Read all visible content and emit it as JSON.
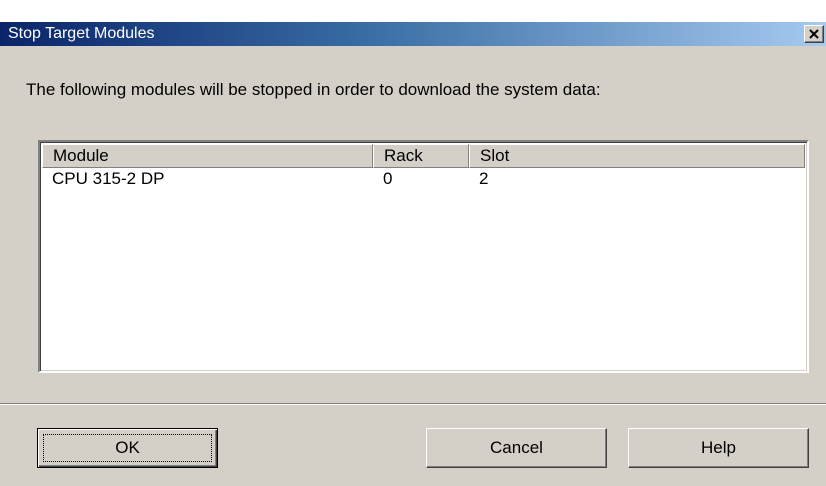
{
  "window": {
    "title": "Stop Target Modules",
    "close_icon": "close-icon"
  },
  "message": "The following modules will be stopped in order to download the system data:",
  "table": {
    "columns": [
      "Module",
      "Rack",
      "Slot"
    ],
    "rows": [
      [
        "CPU 315-2 DP",
        "0",
        "2"
      ]
    ]
  },
  "buttons": {
    "ok_label": "OK",
    "cancel_label": "Cancel",
    "help_label": "Help"
  },
  "colors": {
    "title_bar_start": "#0a246a",
    "title_bar_end": "#a6caf0",
    "dialog_face": "#d4d0c8"
  }
}
